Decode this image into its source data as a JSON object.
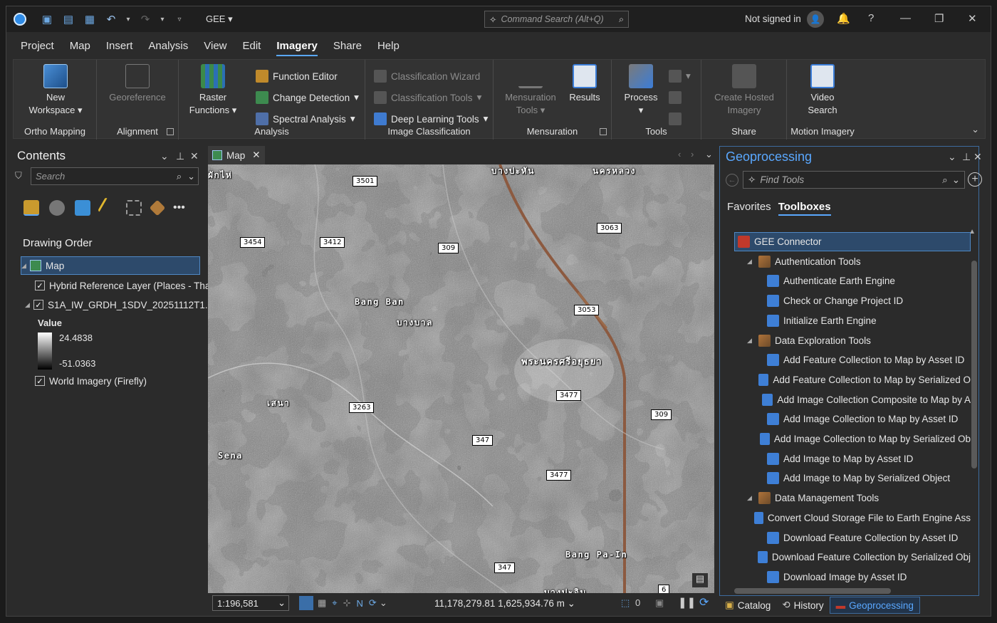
{
  "titlebar": {
    "project_name": "GEE",
    "command_search_placeholder": "Command Search (Alt+Q)",
    "signed_in": "Not signed in",
    "help": "?"
  },
  "menu": [
    "Project",
    "Map",
    "Insert",
    "Analysis",
    "View",
    "Edit",
    "Imagery",
    "Share",
    "Help"
  ],
  "ribbon": {
    "ortho": {
      "btn": "New",
      "btn2": "Workspace",
      "label": "Ortho Mapping"
    },
    "alignment": {
      "btn": "Georeference",
      "label": "Alignment"
    },
    "analysis": {
      "raster": "Raster",
      "raster2": "Functions",
      "function_editor": "Function Editor",
      "change_detection": "Change Detection",
      "spectral": "Spectral Analysis",
      "label": "Analysis"
    },
    "classification": {
      "wizard": "Classification Wizard",
      "tools": "Classification Tools",
      "deep": "Deep Learning Tools",
      "label": "Image Classification"
    },
    "mensuration": {
      "tools": "Mensuration",
      "tools2": "Tools",
      "results": "Results",
      "label": "Mensuration"
    },
    "tools": {
      "process": "Process",
      "label": "Tools"
    },
    "share": {
      "btn": "Create Hosted",
      "btn2": "Imagery",
      "label": "Share"
    },
    "motion": {
      "btn": "Video",
      "btn2": "Search",
      "label": "Motion Imagery"
    }
  },
  "contents": {
    "title": "Contents",
    "search_placeholder": "Search",
    "drawing_order": "Drawing Order",
    "map": "Map",
    "layers": [
      "Hybrid Reference Layer (Places - Thai)",
      "S1A_IW_GRDH_1SDV_20251112T1...",
      "World Imagery (Firefly)"
    ],
    "value_label": "Value",
    "value_max": "24.4838",
    "value_min": "-51.0363"
  },
  "map": {
    "tab": "Map",
    "scale": "1:196,581",
    "coords": "11,178,279.81 1,625,934.76 m",
    "selected_count": "0",
    "road_labels": [
      "3501",
      "3454",
      "3412",
      "309",
      "3063",
      "3053",
      "3477",
      "3263",
      "309",
      "347",
      "3477",
      "347",
      "6"
    ],
    "place_labels": [
      "Bang Ban",
      "บางบาล",
      "พระนครศรีอยุธยา",
      "เสนา",
      "Sena",
      "Bang Pa-In",
      "บางปะหัน",
      "นครหลวง",
      "ผักไห่",
      "บางปะอิน"
    ]
  },
  "geoprocessing": {
    "title": "Geoprocessing",
    "search_placeholder": "Find Tools",
    "tabs": [
      "Favorites",
      "Toolboxes"
    ],
    "tree": [
      {
        "label": "GEE Connector",
        "level": 0,
        "type": "box"
      },
      {
        "label": "Authentication Tools",
        "level": 1,
        "type": "toolset"
      },
      {
        "label": "Authenticate Earth Engine",
        "level": 2,
        "type": "script"
      },
      {
        "label": "Check or Change Project ID",
        "level": 2,
        "type": "script"
      },
      {
        "label": "Initialize Earth Engine",
        "level": 2,
        "type": "script"
      },
      {
        "label": "Data Exploration Tools",
        "level": 1,
        "type": "toolset"
      },
      {
        "label": "Add Feature Collection to Map by Asset ID",
        "level": 2,
        "type": "script"
      },
      {
        "label": "Add Feature Collection to Map by Serialized O",
        "level": 2,
        "type": "script"
      },
      {
        "label": "Add Image Collection Composite to Map by A",
        "level": 2,
        "type": "script"
      },
      {
        "label": "Add Image Collection to Map by Asset ID",
        "level": 2,
        "type": "script"
      },
      {
        "label": "Add Image Collection to Map by Serialized Ob",
        "level": 2,
        "type": "script"
      },
      {
        "label": "Add Image to Map by Asset ID",
        "level": 2,
        "type": "script"
      },
      {
        "label": "Add Image to Map by Serialized Object",
        "level": 2,
        "type": "script"
      },
      {
        "label": "Data Management Tools",
        "level": 1,
        "type": "toolset"
      },
      {
        "label": "Convert Cloud Storage File to Earth Engine Ass",
        "level": 2,
        "type": "script"
      },
      {
        "label": "Download Feature Collection by Asset ID",
        "level": 2,
        "type": "script"
      },
      {
        "label": "Download Feature Collection by Serialized Obj",
        "level": 2,
        "type": "script"
      },
      {
        "label": "Download Image by Asset ID",
        "level": 2,
        "type": "script"
      }
    ]
  },
  "bottom_tabs": [
    "Catalog",
    "History",
    "Geoprocessing"
  ]
}
